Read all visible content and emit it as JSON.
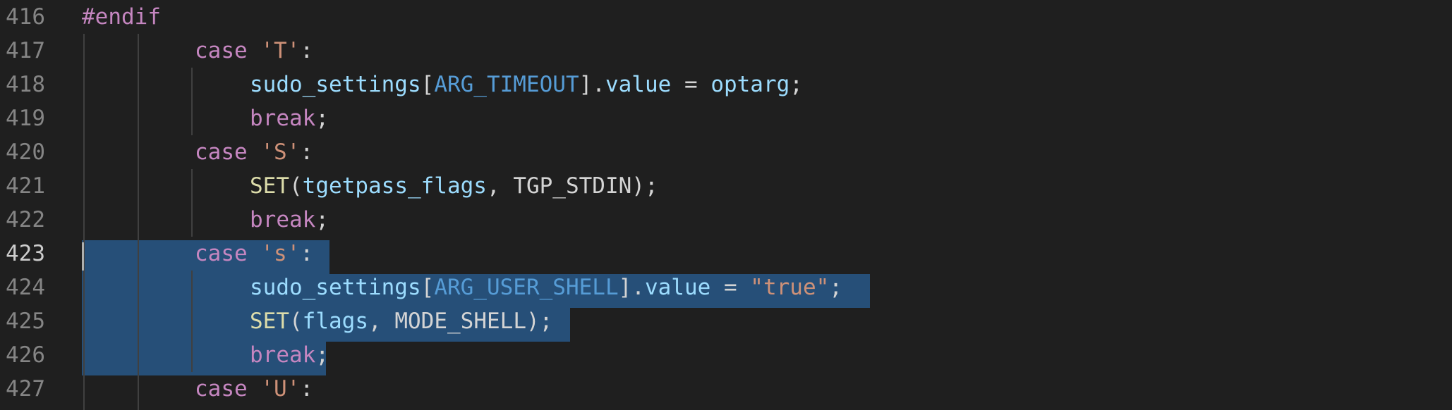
{
  "editor": {
    "lines": [
      {
        "number": "416",
        "text": "#endif"
      },
      {
        "number": "417",
        "text": "case 'T':"
      },
      {
        "number": "418",
        "text": "sudo_settings[ARG_TIMEOUT].value = optarg;"
      },
      {
        "number": "419",
        "text": "break;"
      },
      {
        "number": "420",
        "text": "case 'S':"
      },
      {
        "number": "421",
        "text": "SET(tgetpass_flags, TGP_STDIN);"
      },
      {
        "number": "422",
        "text": "break;"
      },
      {
        "number": "423",
        "text": "case 's':"
      },
      {
        "number": "424",
        "text": "sudo_settings[ARG_USER_SHELL].value = \"true\";"
      },
      {
        "number": "425",
        "text": "SET(flags, MODE_SHELL);"
      },
      {
        "number": "426",
        "text": "break;"
      },
      {
        "number": "427",
        "text": "case 'U':"
      }
    ],
    "active_line": "423",
    "colors": {
      "background": "#1f1f1f",
      "selection": "#264f78",
      "keyword": "#c586c0",
      "string": "#ce9178",
      "variable": "#9cdcfe",
      "constant": "#569cd6",
      "function": "#dcdcaa"
    }
  }
}
